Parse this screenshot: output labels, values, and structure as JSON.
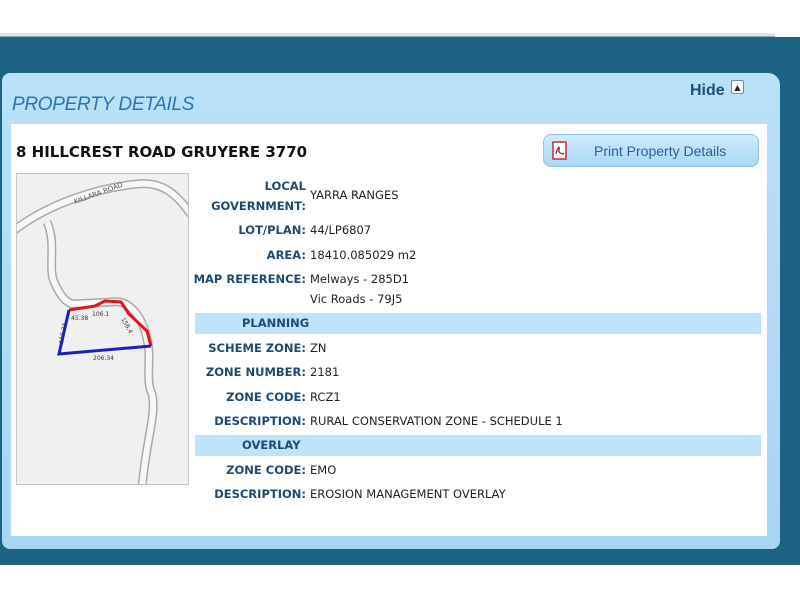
{
  "panel": {
    "title": "PROPERTY DETAILS",
    "hide_label": "Hide",
    "address": "8 HILLCREST ROAD GRUYERE 3770",
    "print_label": "Print Property Details"
  },
  "map": {
    "road_name": "KILLARA ROAD",
    "dimensions": [
      "45.38",
      "106.1",
      "158.4",
      "110.34",
      "206.34"
    ]
  },
  "details": {
    "local_government_label_1": "LOCAL",
    "local_government_label_2": "GOVERNMENT:",
    "local_government": "YARRA RANGES",
    "lot_plan_label": "LOT/PLAN:",
    "lot_plan": "44/LP6807",
    "area_label": "AREA:",
    "area": "18410.085029 m2",
    "map_reference_label": "MAP REFERENCE:",
    "map_reference_1": "Melways - 285D1",
    "map_reference_2": "Vic Roads - 79J5"
  },
  "planning": {
    "heading": "PLANNING",
    "scheme_zone_label": "SCHEME ZONE:",
    "scheme_zone": "ZN",
    "zone_number_label": "ZONE NUMBER:",
    "zone_number": "2181",
    "zone_code_label": "ZONE CODE:",
    "zone_code": "RCZ1",
    "description_label": "DESCRIPTION:",
    "description": "RURAL CONSERVATION ZONE - SCHEDULE 1"
  },
  "overlay": {
    "heading": "OVERLAY",
    "zone_code_label": "ZONE CODE:",
    "zone_code": "EMO",
    "description_label": "DESCRIPTION:",
    "description": "EROSION MANAGEMENT OVERLAY"
  },
  "colors": {
    "band": "#1c6285",
    "panel": "#b3ddf6",
    "section": "#bfe4f9",
    "label": "#1e4a71",
    "boundary_red": "#e0161b",
    "boundary_blue": "#1a1fc4"
  }
}
